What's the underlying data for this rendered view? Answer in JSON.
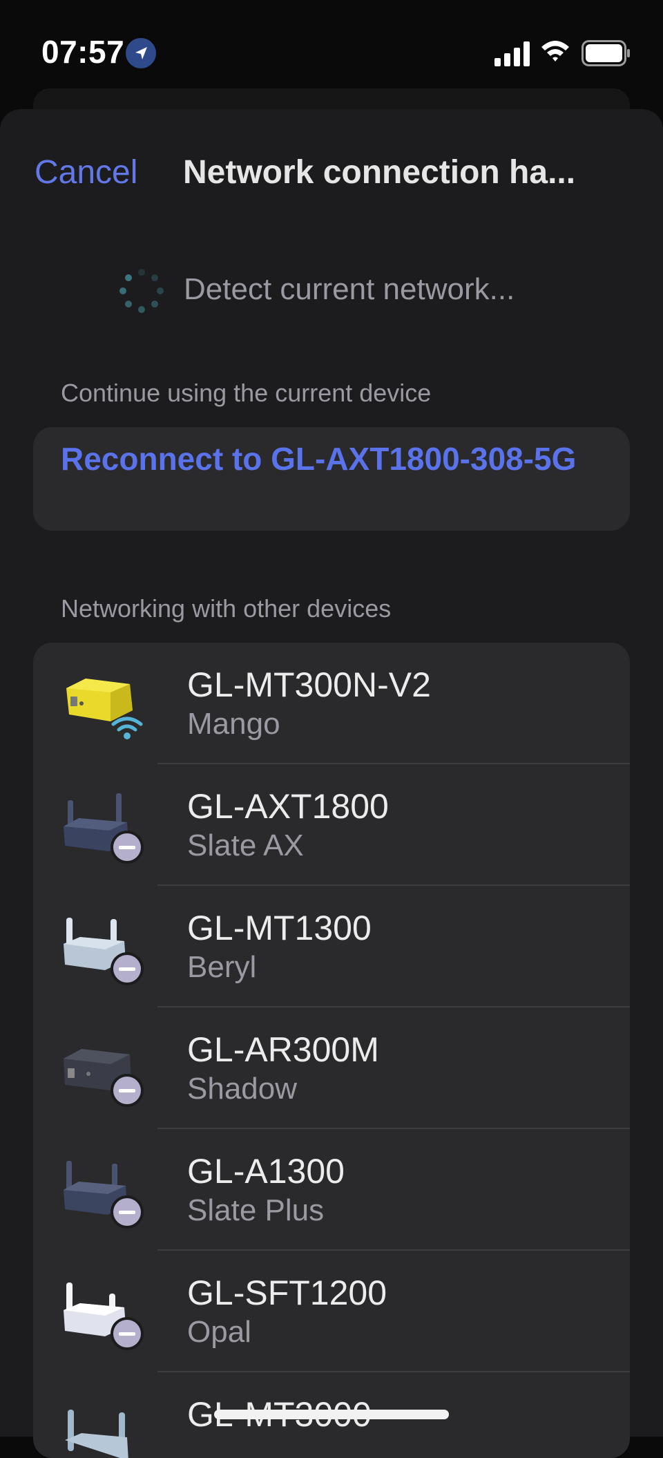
{
  "status_bar": {
    "time": "07:57"
  },
  "header": {
    "cancel_label": "Cancel",
    "title": "Network connection ha..."
  },
  "detect": {
    "text": "Detect current network..."
  },
  "current_section": {
    "label": "Continue using the current device",
    "reconnect_label": "Reconnect to GL-AXT1800-308-5G"
  },
  "other_section": {
    "label": "Networking with other devices",
    "devices": [
      {
        "model": "GL-MT300N-V2",
        "name": "Mango",
        "icon": "mango-router-wifi-icon"
      },
      {
        "model": "GL-AXT1800",
        "name": "Slate AX",
        "icon": "slate-ax-router-icon"
      },
      {
        "model": "GL-MT1300",
        "name": "Beryl",
        "icon": "beryl-router-icon"
      },
      {
        "model": "GL-AR300M",
        "name": "Shadow",
        "icon": "shadow-router-icon"
      },
      {
        "model": "GL-A1300",
        "name": "Slate Plus",
        "icon": "slate-plus-router-icon"
      },
      {
        "model": "GL-SFT1200",
        "name": "Opal",
        "icon": "opal-router-icon"
      },
      {
        "model": "GL-MT3000",
        "name": "",
        "icon": "mt3000-router-icon"
      }
    ]
  },
  "colors": {
    "accent": "#6278e6",
    "link": "#5a72ea",
    "sheet_bg": "#1c1c1e",
    "card_bg": "#2a2a2c",
    "secondary_text": "#9a9aa2"
  }
}
